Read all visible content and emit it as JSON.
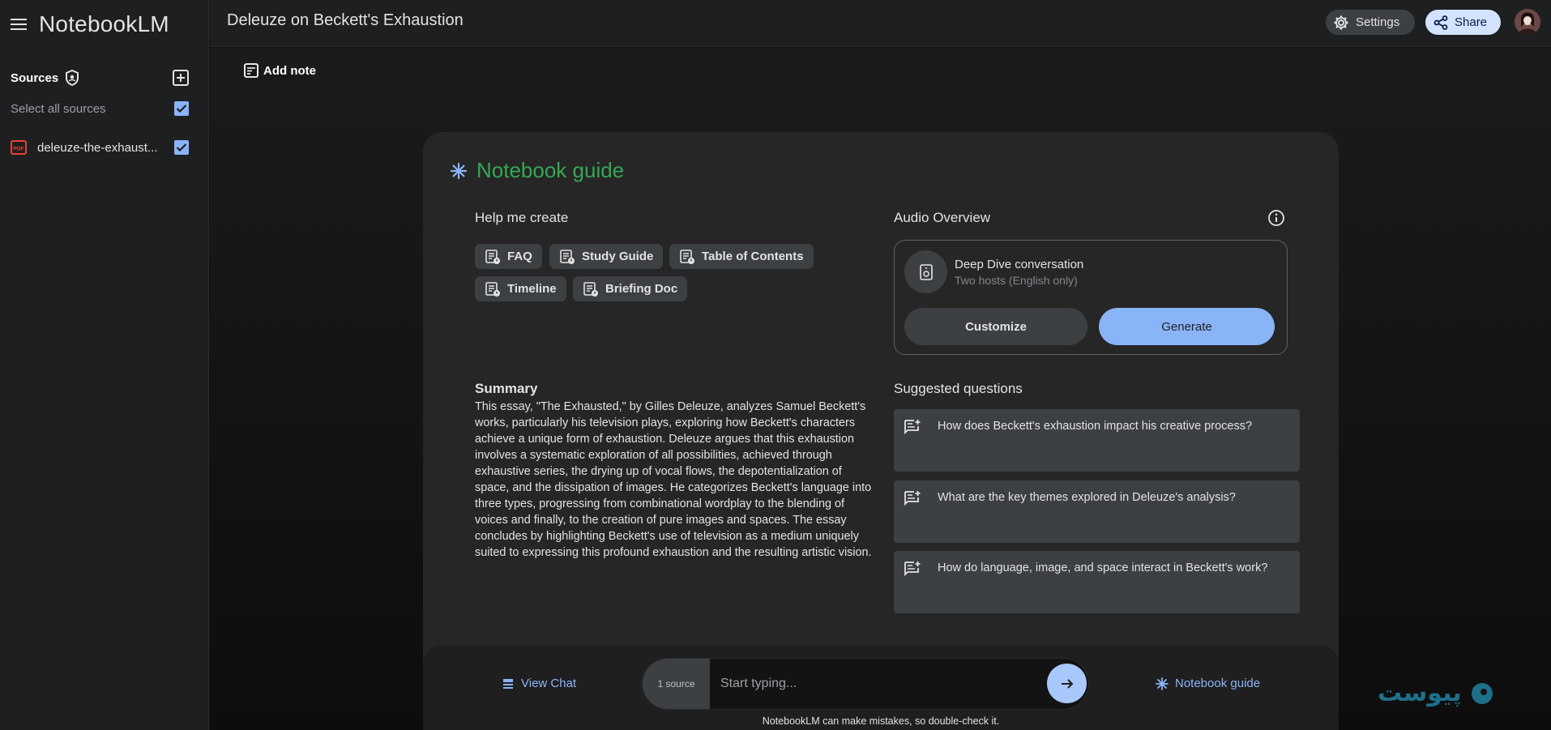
{
  "app": {
    "name": "NotebookLM"
  },
  "sidebar": {
    "sources_title": "Sources",
    "select_all_label": "Select all sources",
    "sources": [
      {
        "name": "deleuze-the-exhaust...",
        "type": "pdf",
        "checked": true
      }
    ]
  },
  "header": {
    "notebook_title": "Deleuze on Beckett's Exhaustion",
    "settings_label": "Settings",
    "share_label": "Share"
  },
  "main": {
    "add_note_label": "Add note"
  },
  "guide": {
    "title": "Notebook guide",
    "help_title": "Help me create",
    "chips": [
      {
        "label": "FAQ"
      },
      {
        "label": "Study Guide"
      },
      {
        "label": "Table of Contents"
      },
      {
        "label": "Timeline"
      },
      {
        "label": "Briefing Doc"
      }
    ],
    "audio": {
      "title": "Audio Overview",
      "type_title": "Deep Dive conversation",
      "type_sub": "Two hosts (English only)",
      "customize_label": "Customize",
      "generate_label": "Generate"
    },
    "summary_title": "Summary",
    "summary_text": "This essay, \"The Exhausted,\" by Gilles Deleuze, analyzes Samuel Beckett's works, particularly his television plays, exploring how Beckett's characters achieve a unique form of exhaustion. Deleuze argues that this exhaustion involves a systematic exploration of all possibilities, achieved through exhaustive series, the drying up of vocal flows, the depotentialization of space, and the dissipation of images. He categorizes Beckett's language into three types, progressing from combinational wordplay to the blending of voices and finally, to the creation of pure images and spaces. The essay concludes by highlighting Beckett's use of television as a medium uniquely suited to expressing this profound exhaustion and the resulting artistic vision.",
    "suggested_title": "Suggested questions",
    "questions": [
      "How does Beckett's exhaustion impact his creative process?",
      "What are the key themes explored in Deleuze's analysis?",
      "How do language, image, and space interact in Beckett's work?"
    ]
  },
  "chat": {
    "view_chat_label": "View Chat",
    "source_count": "1 source",
    "input_placeholder": "Start typing...",
    "guide_link_label": "Notebook guide",
    "disclaimer": "NotebookLM can make mistakes, so double-check it."
  },
  "watermark": {
    "text": "پیوست"
  },
  "colors": {
    "accent_blue": "#8ab4f8",
    "guide_green": "#34a853",
    "share_bg": "#d3e3fd"
  }
}
